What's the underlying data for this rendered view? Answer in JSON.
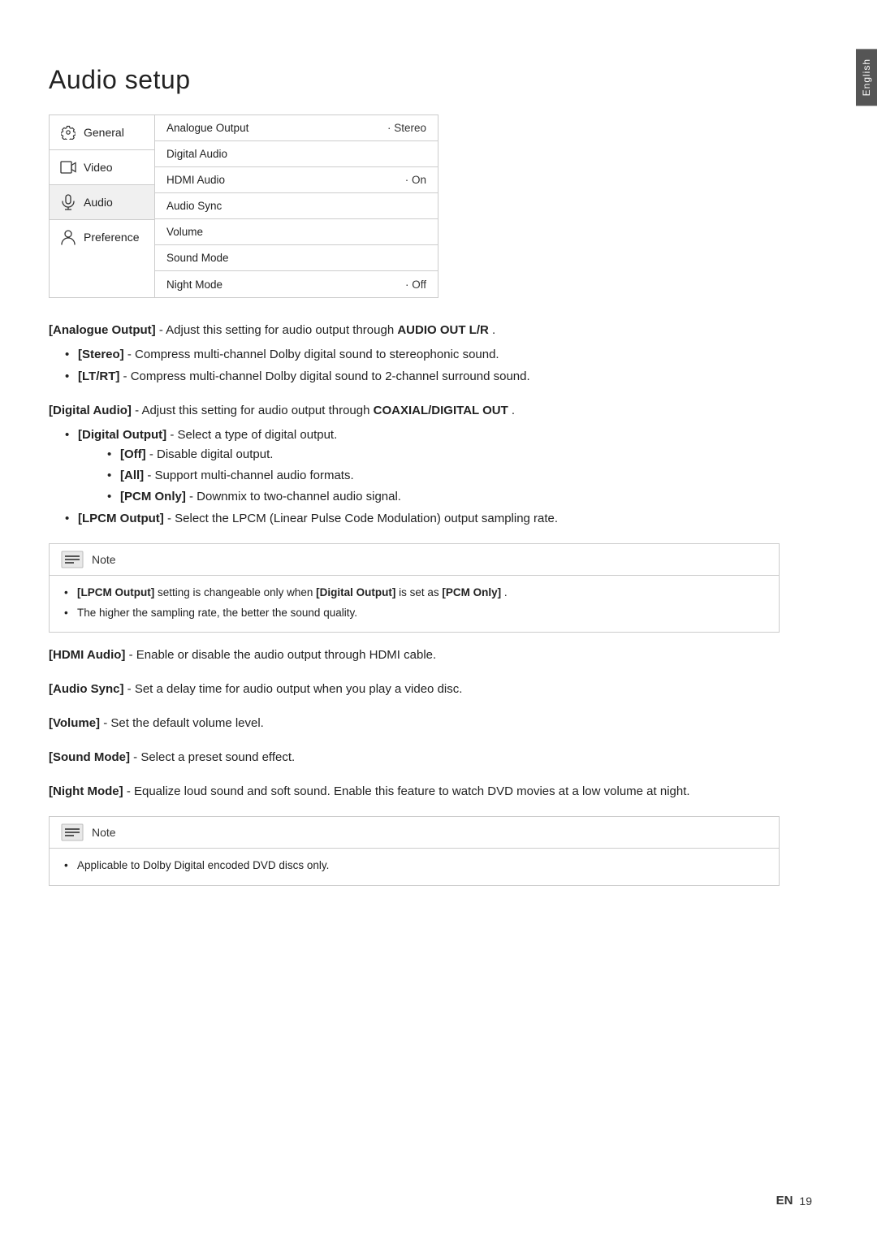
{
  "page": {
    "title": "Audio setup",
    "language_tab": "English",
    "footer_lang": "EN",
    "footer_page": "19"
  },
  "menu": {
    "left_items": [
      {
        "id": "general",
        "label": "General",
        "icon": "gear"
      },
      {
        "id": "video",
        "label": "Video",
        "icon": "video"
      },
      {
        "id": "audio",
        "label": "Audio",
        "icon": "audio",
        "active": true
      },
      {
        "id": "preference",
        "label": "Preference",
        "icon": "person"
      }
    ],
    "right_rows": [
      {
        "label": "Analogue Output",
        "value": "· Stereo"
      },
      {
        "label": "Digital Audio",
        "value": ""
      },
      {
        "label": "HDMI Audio",
        "value": "· On"
      },
      {
        "label": "Audio Sync",
        "value": ""
      },
      {
        "label": "Volume",
        "value": ""
      },
      {
        "label": "Sound Mode",
        "value": ""
      },
      {
        "label": "Night Mode",
        "value": "· Off"
      }
    ]
  },
  "sections": [
    {
      "id": "analogue-output",
      "intro_bracket": "[Analogue Output]",
      "intro_text": " - Adjust this setting for audio output through ",
      "intro_highlight": "AUDIO OUT L/R",
      "intro_end": " .",
      "bullets": [
        {
          "bracket": "[Stereo]",
          "text": " - Compress multi-channel Dolby digital sound to stereophonic sound."
        },
        {
          "bracket": "[LT/RT]",
          "text": " - Compress multi-channel Dolby digital sound to 2-channel surround sound."
        }
      ]
    },
    {
      "id": "digital-audio",
      "intro_bracket": "[Digital Audio]",
      "intro_text": " - Adjust this setting for audio output through ",
      "intro_highlight": "COAXIAL/DIGITAL OUT",
      "intro_end": ".",
      "bullets": [
        {
          "bracket": "[Digital Output]",
          "text": " - Select a type of digital output.",
          "sub_bullets": [
            {
              "bracket": "[Off]",
              "text": " - Disable digital output."
            },
            {
              "bracket": "[All]",
              "text": " - Support multi-channel audio formats."
            },
            {
              "bracket": "[PCM Only]",
              "text": " - Downmix to two-channel audio signal."
            }
          ]
        },
        {
          "bracket": "[LPCM Output]",
          "text": " - Select the LPCM (Linear Pulse Code Modulation) output sampling rate."
        }
      ]
    }
  ],
  "note1": {
    "title": "Note",
    "items": [
      {
        "text_parts": [
          {
            "type": "bold",
            "text": "[LPCM Output]"
          },
          {
            "type": "normal",
            "text": " setting is changeable only when "
          },
          {
            "type": "bold",
            "text": "[Digital Output]"
          },
          {
            "type": "normal",
            "text": " is set as "
          },
          {
            "type": "bold",
            "text": "[PCM Only]"
          },
          {
            "type": "normal",
            "text": "."
          }
        ]
      },
      {
        "text": "The higher the sampling rate, the better the sound quality."
      }
    ]
  },
  "single_sections": [
    {
      "id": "hdmi-audio",
      "bracket": "[HDMI Audio]",
      "text": " - Enable or disable the audio output through HDMI cable."
    },
    {
      "id": "audio-sync",
      "bracket": "[Audio Sync]",
      "text": " - Set a delay time for audio output when you play a video disc."
    },
    {
      "id": "volume",
      "bracket": "[Volume]",
      "text": " - Set the default volume level."
    },
    {
      "id": "sound-mode",
      "bracket": "[Sound Mode]",
      "text": " - Select a preset sound effect."
    },
    {
      "id": "night-mode",
      "bracket": "[Night Mode]",
      "text": " - Equalize loud sound and soft sound. Enable this feature to watch DVD movies at a low volume at night."
    }
  ],
  "note2": {
    "title": "Note",
    "items": [
      {
        "text": "Applicable to Dolby Digital encoded DVD discs only."
      }
    ]
  }
}
